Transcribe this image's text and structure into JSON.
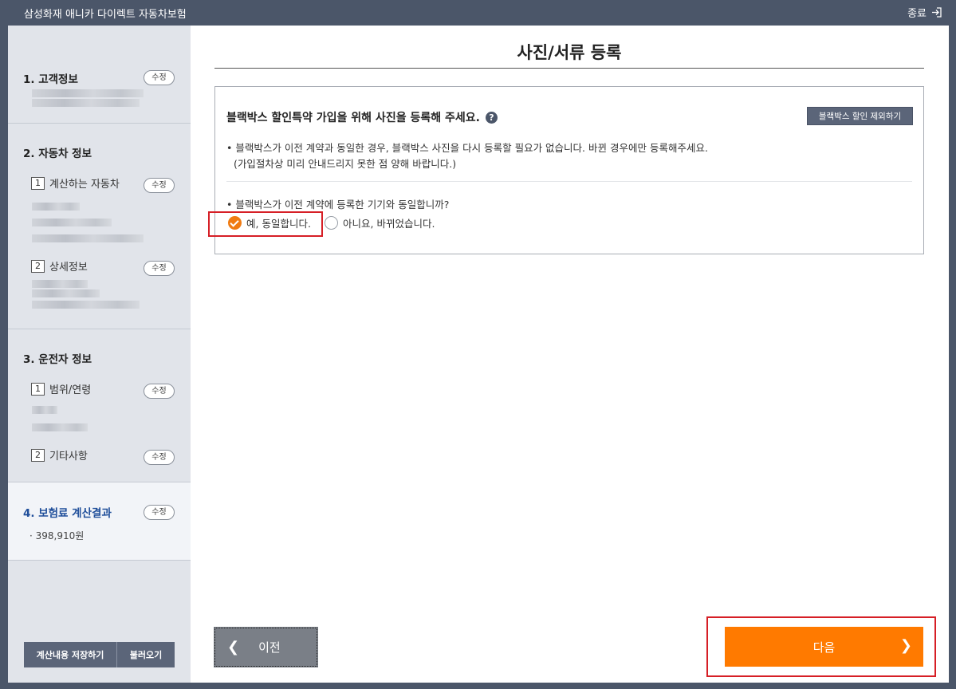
{
  "window": {
    "title": "삼성화재 애니카 다이렉트 자동차보험",
    "close_label": "종료",
    "close_icon": "exit-icon"
  },
  "sidebar": {
    "edit_label": "수정",
    "sections": [
      {
        "title": "1. 고객정보"
      },
      {
        "title": "2. 자동차 정보",
        "items": [
          {
            "num": "1",
            "label": "계산하는 자동차"
          },
          {
            "num": "2",
            "label": "상세정보"
          }
        ]
      },
      {
        "title": "3. 운전자 정보",
        "items": [
          {
            "num": "1",
            "label": "범위/연령"
          },
          {
            "num": "2",
            "label": "기타사항"
          }
        ]
      },
      {
        "title": "4. 보험료 계산결과",
        "value": "· 398,910원"
      }
    ],
    "save_label": "계산내용 저장하기",
    "load_label": "불러오기"
  },
  "main": {
    "page_title": "사진/서류 등록",
    "panel": {
      "heading": "블랙박스 할인특약 가입을 위해 사진을 등록해 주세요.",
      "help_icon": "?",
      "exclude_button": "블랙박스 할인 제외하기",
      "note_line1": "• 블랙박스가 이전 계약과 동일한 경우, 블랙박스 사진을 다시 등록할 필요가 없습니다. 바뀐 경우에만 등록해주세요.",
      "note_line2": "(가입절차상 미리 안내드리지 못한 점 양해 바랍니다.)",
      "question": "• 블랙박스가 이전 계약에 등록한 기기와 동일합니까?",
      "option_yes": "예, 동일합니다.",
      "option_no": "아니요, 바뀌었습니다.",
      "selected": "yes"
    },
    "prev_label": "이전",
    "next_label": "다음"
  },
  "colors": {
    "accent": "#ff7a00",
    "header": "#4b5669",
    "highlight": "#d61f26"
  }
}
